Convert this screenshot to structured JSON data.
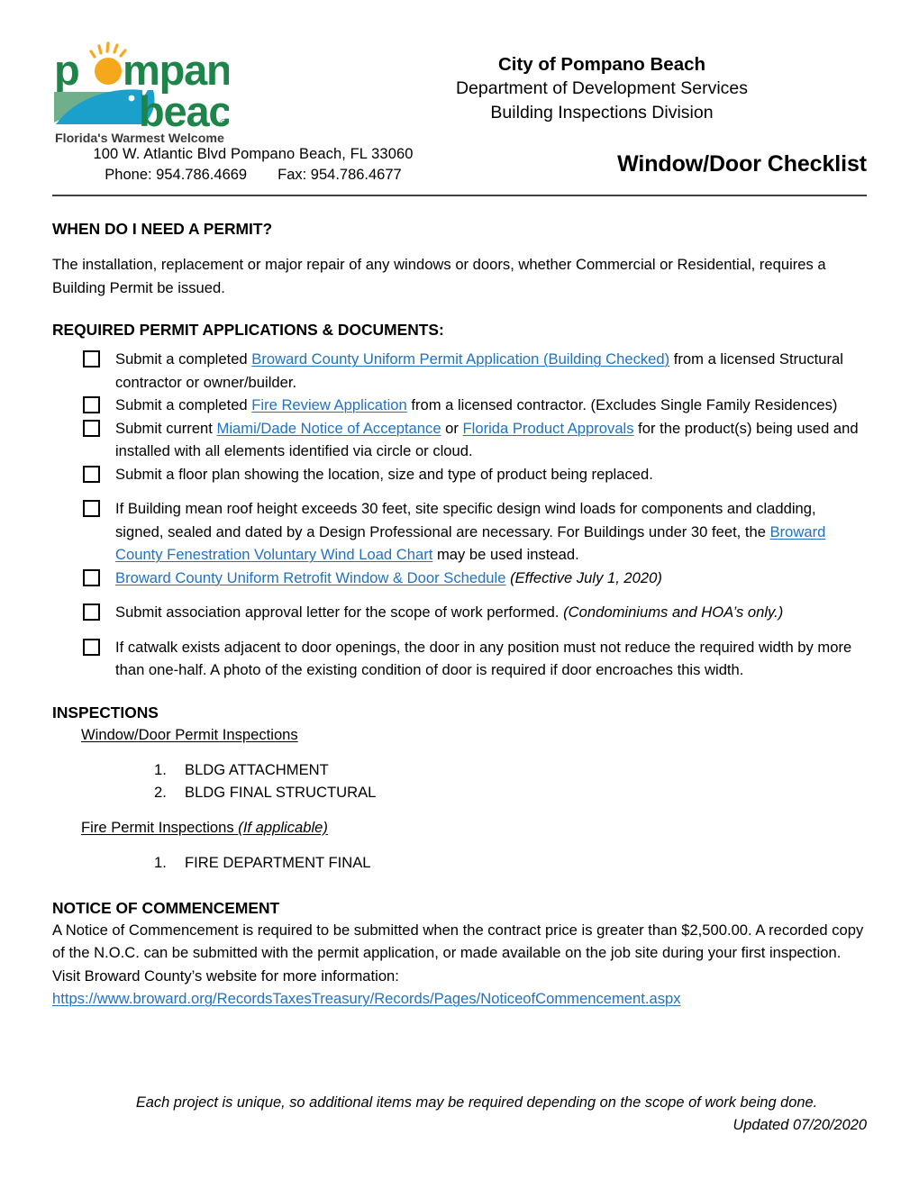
{
  "header": {
    "logo": {
      "word_top": "pompano",
      "word_bottom": "beach",
      "tagline": "Florida's Warmest Welcome",
      "registered_mark": "®",
      "colors": {
        "green": "#1E8449",
        "sun": "#F5A81C",
        "fish_blue": "#1B9FCB",
        "rect_green": "#6FAF8C"
      }
    },
    "org_title": "City of Pompano Beach",
    "department": "Department of Development Services",
    "division": "Building Inspections Division",
    "address": "100 W. Atlantic Blvd Pompano Beach, FL 33060",
    "phone_label": "Phone: 954.786.4669",
    "fax_label": "Fax: 954.786.4677",
    "document_title": "Window/Door Checklist"
  },
  "sections": {
    "when_permit": {
      "heading": "WHEN DO I NEED A PERMIT?",
      "paragraph": "The installation, replacement or major repair of any windows or doors, whether Commercial or Residential, requires a Building Permit be issued."
    },
    "required_docs": {
      "heading": "REQUIRED PERMIT APPLICATIONS & DOCUMENTS:",
      "items": [
        {
          "pre": "Submit a completed ",
          "link": "Broward County Uniform Permit Application (Building Checked)",
          "post": " from a licensed Structural contractor or owner/builder.",
          "spaced": false
        },
        {
          "pre": "Submit a completed ",
          "link": "Fire Review Application",
          "post": " from a licensed contractor. (Excludes Single Family Residences)",
          "spaced": false
        },
        {
          "pre": "Submit current ",
          "link": "Miami/Dade Notice of Acceptance",
          "mid": " or ",
          "link2": "Florida Product Approvals",
          "post": " for the product(s) being used and installed with all elements identified via circle or cloud.",
          "spaced": false
        },
        {
          "pre": "Submit a floor plan showing the location, size and type of product being replaced.",
          "spaced": false
        },
        {
          "pre": "If Building mean roof height exceeds 30 feet, site specific design wind loads for components and cladding, signed, sealed and dated by a Design Professional are necessary. For Buildings under 30 feet, the ",
          "link": "Broward County Fenestration Voluntary Wind Load Chart",
          "post": " may be used instead.",
          "spaced": true
        },
        {
          "link": "Broward County Uniform Retrofit Window & Door Schedule",
          "italic_post": " (Effective July 1, 2020)",
          "spaced": false
        },
        {
          "pre": "Submit association approval letter for the scope of work performed. ",
          "italic_post": "(Condominiums and HOA’s only.)",
          "spaced": true
        },
        {
          "pre": "If catwalk exists adjacent to door openings, the door in any position must not reduce the required width by more than one-half.  A photo of the existing condition of door is required if door encroaches this width.",
          "spaced": true
        }
      ]
    },
    "inspections": {
      "heading": "INSPECTIONS",
      "group1_label": "Window/Door Permit Inspections",
      "group1_items": [
        {
          "num": "1.",
          "label": "BLDG ATTACHMENT"
        },
        {
          "num": "2.",
          "label": "BLDG  FINAL STRUCTURAL"
        }
      ],
      "group2_label": "Fire Permit Inspections ",
      "group2_label_italic": "(If applicable)",
      "group2_items": [
        {
          "num": "1.",
          "label": "FIRE DEPARTMENT FINAL"
        }
      ]
    },
    "notice": {
      "heading": "NOTICE OF COMMENCEMENT",
      "paragraph": "A Notice of Commencement is required to be submitted when the contract price is greater than $2,500.00. A recorded copy of the N.O.C. can be submitted with the permit application, or made available on the job site during your first inspection. Visit Broward County’s website for more information:",
      "url": "https://www.broward.org/RecordsTaxesTreasury/Records/Pages/NoticeofCommencement.aspx"
    }
  },
  "footer": {
    "note": "Each project is unique, so additional items may be required depending on the scope of work being done.",
    "updated": "Updated 07/20/2020"
  },
  "colors": {
    "link": "#2072C4",
    "rule": "#3f3f3f"
  }
}
